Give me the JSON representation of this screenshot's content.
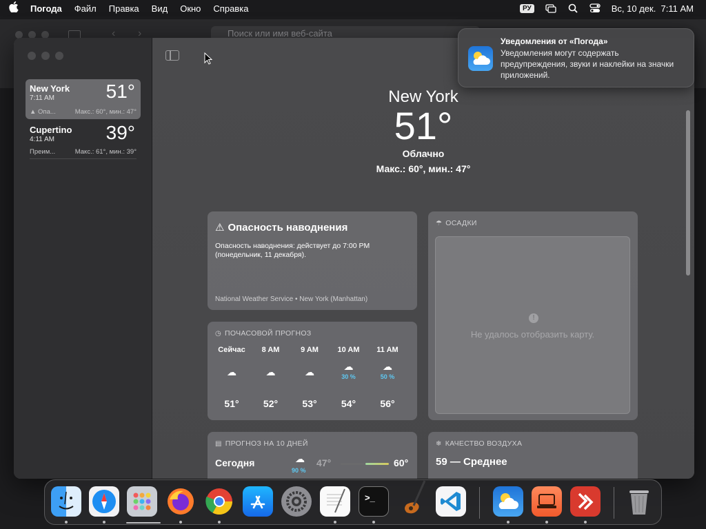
{
  "menubar": {
    "app_name": "Погода",
    "items": [
      "Файл",
      "Правка",
      "Вид",
      "Окно",
      "Справка"
    ],
    "input_lang": "РУ",
    "datetime": "Вс, 10 дек.  7:11 AM"
  },
  "background_browser": {
    "url_placeholder": "Поиск или имя веб-сайта"
  },
  "sidebar": {
    "cities": [
      {
        "name": "New York",
        "time": "7:11 AM",
        "temp": "51°",
        "alert": "Опа...",
        "range": "Макс.: 60°, мин.: 47°",
        "selected": true
      },
      {
        "name": "Cupertino",
        "time": "4:11 AM",
        "temp": "39°",
        "alert": "Преим...",
        "range": "Макс.: 61°, мин.: 39°",
        "selected": false
      }
    ]
  },
  "hero": {
    "city": "New York",
    "temp": "51°",
    "condition": "Облачно",
    "range": "Макс.: 60°, мин.: 47°"
  },
  "flood": {
    "title": "Опасность наводнения",
    "body": "Опасность наводнения: действует до 7:00 PM (понедельник, 11 декабря).",
    "source": "National Weather Service • New York (Manhattan)"
  },
  "hourly": {
    "header": "ПОЧАСОВОЙ ПРОГНОЗ",
    "hours": [
      {
        "label": "Сейчас",
        "icon": "cloud-icon",
        "pct": "",
        "temp": "51°"
      },
      {
        "label": "8 AM",
        "icon": "cloud-icon",
        "pct": "",
        "temp": "52°"
      },
      {
        "label": "9 AM",
        "icon": "cloud-icon",
        "pct": "",
        "temp": "53°"
      },
      {
        "label": "10 AM",
        "icon": "cloud-rain-icon",
        "pct": "30 %",
        "temp": "54°"
      },
      {
        "label": "11 AM",
        "icon": "cloud-rain-icon",
        "pct": "50 %",
        "temp": "56°"
      }
    ]
  },
  "precip": {
    "header": "ОСАДКИ",
    "error": "Не удалось отобразить карту."
  },
  "tenday": {
    "header": "ПРОГНОЗ НА 10 ДНЕЙ",
    "first_day": "Сегодня",
    "first_pct": "90 %",
    "first_low": "47°",
    "first_high": "60°"
  },
  "airquality": {
    "header": "КАЧЕСТВО ВОЗДУХА",
    "value": "59 — Среднее"
  },
  "notification": {
    "title": "Уведомления от «Погода»",
    "body": "Уведомления могут содержать предупреждения, звуки и наклейки на значки приложений."
  },
  "dock": {
    "apps": [
      "Finder",
      "Safari",
      "Launchpad",
      "Firefox",
      "Chrome",
      "App Store",
      "Системные настройки",
      "TextEdit",
      "Терминал",
      "GarageBand",
      "VS Code",
      "Погода",
      "Remote Desktop",
      "Microsoft Remote Desktop",
      "Корзина"
    ]
  }
}
